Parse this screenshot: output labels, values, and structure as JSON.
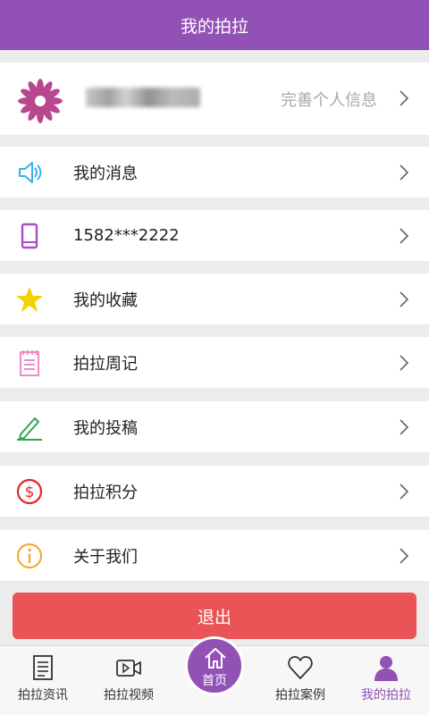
{
  "header": {
    "title": "我的拍拉"
  },
  "profile": {
    "hint": "完善个人信息"
  },
  "menu": [
    {
      "label": "我的消息",
      "icon": "speaker-icon"
    },
    {
      "label": "1582***2222",
      "icon": "phone-icon"
    },
    {
      "label": "我的收藏",
      "icon": "star-icon"
    },
    {
      "label": "拍拉周记",
      "icon": "notepad-icon"
    },
    {
      "label": "我的投稿",
      "icon": "pencil-icon"
    },
    {
      "label": "拍拉积分",
      "icon": "dollar-icon"
    },
    {
      "label": "关于我们",
      "icon": "info-icon"
    }
  ],
  "logout": {
    "label": "退出"
  },
  "tabs": [
    {
      "label": "拍拉资讯",
      "icon": "news-icon"
    },
    {
      "label": "拍拉视频",
      "icon": "video-icon"
    },
    {
      "label": "首页",
      "icon": "home-icon"
    },
    {
      "label": "拍拉案例",
      "icon": "heart-icon"
    },
    {
      "label": "我的拍拉",
      "icon": "user-icon"
    }
  ],
  "colors": {
    "brand": "#9251b5",
    "logout": "#ea5456"
  }
}
